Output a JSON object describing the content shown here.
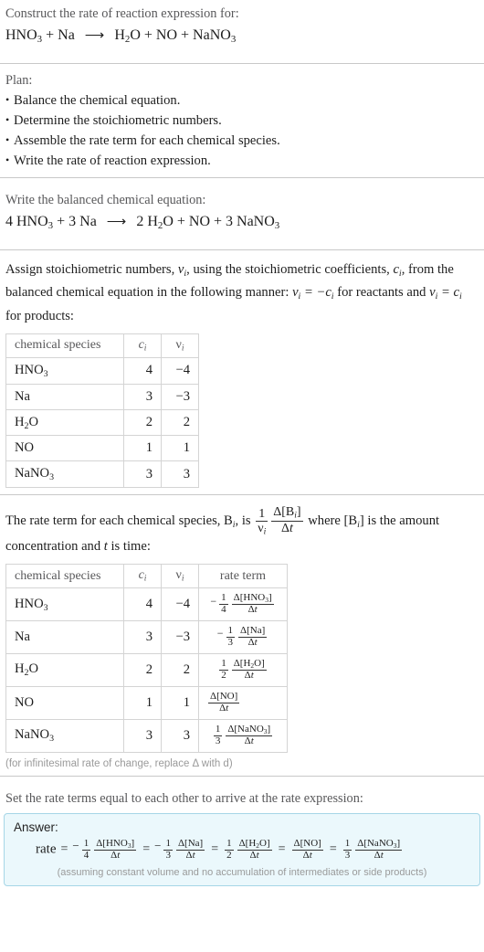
{
  "header": {
    "prompt": "Construct the rate of reaction expression for:",
    "equation": {
      "reactants": [
        "HNO_3",
        "Na"
      ],
      "products": [
        "H_2O",
        "NO",
        "NaNO_3"
      ],
      "arrow": "⟶"
    }
  },
  "plan": {
    "label": "Plan:",
    "items": [
      "Balance the chemical equation.",
      "Determine the stoichiometric numbers.",
      "Assemble the rate term for each chemical species.",
      "Write the rate of reaction expression."
    ]
  },
  "balanced": {
    "prompt": "Write the balanced chemical equation:",
    "text": "4 HNO_3 + 3 Na ⟶ 2 H_2O + NO + 3 NaNO_3"
  },
  "stoich": {
    "paragraph_1": "Assign stoichiometric numbers, ",
    "paragraph_2": ", using the stoichiometric coefficients, ",
    "paragraph_3": ", from the balanced chemical equation in the following manner: ",
    "paragraph_4": " for reactants and ",
    "paragraph_5": " for products:",
    "nu_i": "ν_i",
    "c_i": "c_i",
    "rule_reactants": "ν_i = −c_i",
    "rule_products": "ν_i = c_i",
    "table": {
      "headers": [
        "chemical species",
        "c_i",
        "ν_i"
      ],
      "rows": [
        {
          "species": "HNO_3",
          "c": "4",
          "nu": "−4"
        },
        {
          "species": "Na",
          "c": "3",
          "nu": "−3"
        },
        {
          "species": "H_2O",
          "c": "2",
          "nu": "2"
        },
        {
          "species": "NO",
          "c": "1",
          "nu": "1"
        },
        {
          "species": "NaNO_3",
          "c": "3",
          "nu": "3"
        }
      ]
    }
  },
  "rateterm": {
    "text_1": "The rate term for each chemical species, ",
    "b_i": "B_i",
    "text_2": ", is ",
    "formula": "1/ν_i · Δ[B_i]/Δt",
    "text_3": " where ",
    "b_i_bracket": "[B_i]",
    "text_4": " is the amount concentration and ",
    "t": "t",
    "text_5": " is time:",
    "table": {
      "headers": [
        "chemical species",
        "c_i",
        "ν_i",
        "rate term"
      ],
      "rows": [
        {
          "species": "HNO_3",
          "c": "4",
          "nu": "−4",
          "sign": "−",
          "coef_num": "1",
          "coef_den": "4",
          "delta_num": "Δ[HNO_3]",
          "delta_den": "Δt"
        },
        {
          "species": "Na",
          "c": "3",
          "nu": "−3",
          "sign": "−",
          "coef_num": "1",
          "coef_den": "3",
          "delta_num": "Δ[Na]",
          "delta_den": "Δt"
        },
        {
          "species": "H_2O",
          "c": "2",
          "nu": "2",
          "sign": "",
          "coef_num": "1",
          "coef_den": "2",
          "delta_num": "Δ[H_2O]",
          "delta_den": "Δt"
        },
        {
          "species": "NO",
          "c": "1",
          "nu": "1",
          "sign": "",
          "coef_num": "",
          "coef_den": "",
          "delta_num": "Δ[NO]",
          "delta_den": "Δt"
        },
        {
          "species": "NaNO_3",
          "c": "3",
          "nu": "3",
          "sign": "",
          "coef_num": "1",
          "coef_den": "3",
          "delta_num": "Δ[NaNO_3]",
          "delta_den": "Δt"
        }
      ]
    },
    "note": "(for infinitesimal rate of change, replace Δ with d)"
  },
  "answer": {
    "prompt": "Set the rate terms equal to each other to arrive at the rate expression:",
    "label": "Answer:",
    "rate_word": "rate",
    "equals": "=",
    "terms": [
      {
        "sign": "−",
        "coef_num": "1",
        "coef_den": "4",
        "delta_num": "Δ[HNO_3]",
        "delta_den": "Δt"
      },
      {
        "sign": "−",
        "coef_num": "1",
        "coef_den": "3",
        "delta_num": "Δ[Na]",
        "delta_den": "Δt"
      },
      {
        "sign": "",
        "coef_num": "1",
        "coef_den": "2",
        "delta_num": "Δ[H_2O]",
        "delta_den": "Δt"
      },
      {
        "sign": "",
        "coef_num": "",
        "coef_den": "",
        "delta_num": "Δ[NO]",
        "delta_den": "Δt"
      },
      {
        "sign": "",
        "coef_num": "1",
        "coef_den": "3",
        "delta_num": "Δ[NaNO_3]",
        "delta_den": "Δt"
      }
    ],
    "note": "(assuming constant volume and no accumulation of intermediates or side products)"
  },
  "colors": {
    "answer_bg": "#ebf8fc",
    "answer_border": "#a6d6e6",
    "rule": "#c8c8c8",
    "prompt_text": "#58585a",
    "body_text": "#1d1d1d"
  }
}
